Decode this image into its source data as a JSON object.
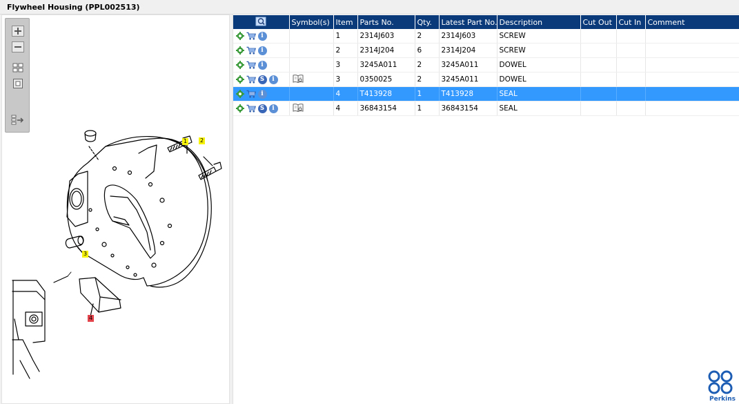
{
  "window": {
    "title": "Flywheel Housing (PPL002513)"
  },
  "zoom_toolbar": {
    "buttons": [
      "zoom-in-icon",
      "zoom-out-icon",
      "fit-all-icon",
      "fit-window-icon",
      "expand-panel-icon"
    ]
  },
  "drawing": {
    "callouts": [
      "1",
      "2",
      "3",
      "4"
    ]
  },
  "table": {
    "headers": {
      "tools": "",
      "symbols": "Symbol(s)",
      "item": "Item",
      "parts_no": "Parts No.",
      "qty": "Qty.",
      "latest": "Latest Part No.",
      "description": "Description",
      "cut_out": "Cut Out",
      "cut_in": "Cut In",
      "comment": "Comment"
    },
    "rows": [
      {
        "item": "1",
        "parts_no": "2314J603",
        "qty": "2",
        "latest": "2314J603",
        "description": "SCREW",
        "cut_out": "",
        "cut_in": "",
        "comment": ""
      },
      {
        "item": "2",
        "parts_no": "2314J204",
        "qty": "6",
        "latest": "2314J204",
        "description": "SCREW",
        "cut_out": "",
        "cut_in": "",
        "comment": ""
      },
      {
        "item": "3",
        "parts_no": "3245A011",
        "qty": "2",
        "latest": "3245A011",
        "description": "DOWEL",
        "cut_out": "",
        "cut_in": "",
        "comment": ""
      },
      {
        "item": "3",
        "parts_no": "0350025",
        "qty": "2",
        "latest": "3245A011",
        "description": "DOWEL",
        "cut_out": "",
        "cut_in": "",
        "comment": ""
      },
      {
        "item": "4",
        "parts_no": "T413928",
        "qty": "1",
        "latest": "T413928",
        "description": "SEAL",
        "cut_out": "",
        "cut_in": "",
        "comment": ""
      },
      {
        "item": "4",
        "parts_no": "36843154",
        "qty": "1",
        "latest": "36843154",
        "description": "SEAL",
        "cut_out": "",
        "cut_in": "",
        "comment": ""
      }
    ],
    "selected_row": 4
  },
  "brand": {
    "name": "Perkins",
    "color": "#1d5db3"
  },
  "colors": {
    "header": "#0a3a7a",
    "selection": "#3399ff",
    "callout_yellow": "#f7f20a",
    "callout_red": "#e3434a"
  }
}
